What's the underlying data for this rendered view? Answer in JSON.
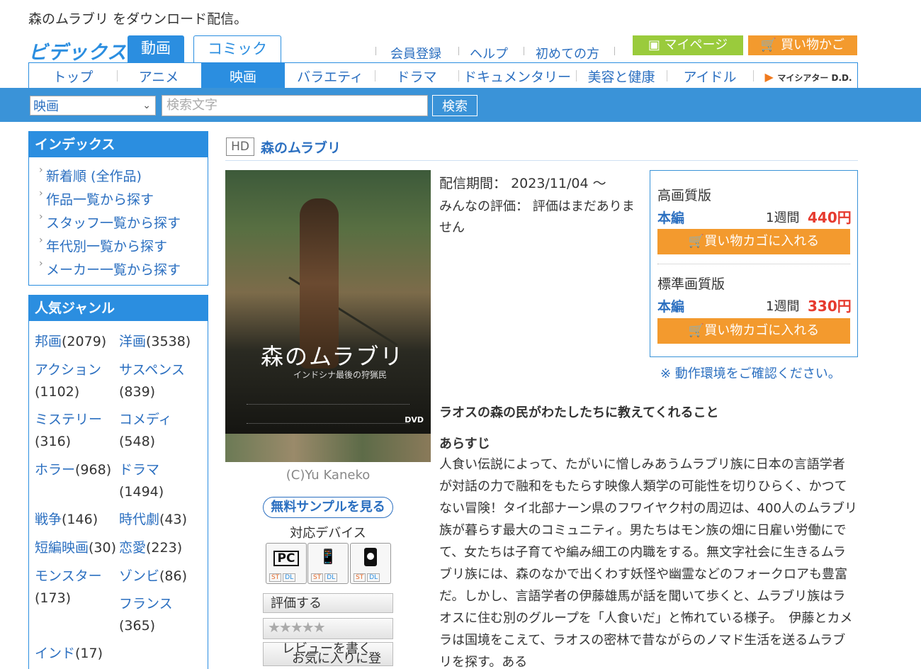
{
  "header": {
    "tagline": "森のムラブリ をダウンロード配信。",
    "logo": "ビデックス",
    "tabs": {
      "douga": "動画",
      "comic": "コミック"
    },
    "links": [
      "会員登録",
      "ヘルプ",
      "初めての方"
    ],
    "mypage": "マイページ",
    "cart": "買い物かご"
  },
  "categories": [
    "トップ",
    "アニメ",
    "映画",
    "バラエティ",
    "ドラマ",
    "ドキュメンタリー",
    "美容と健康",
    "アイドル",
    "マイシアター D.D."
  ],
  "search": {
    "selected": "映画",
    "placeholder": "検索文字",
    "button": "検索"
  },
  "sidebar": {
    "index_title": "インデックス",
    "index_items": [
      "新着順 (全作品)",
      "作品一覧から探す",
      "スタッフ一覧から探す",
      "年代別一覧から探す",
      "メーカー一覧から探す"
    ],
    "genre_title": "人気ジャンル",
    "genres": [
      {
        "name": "邦画",
        "count": "(2079)"
      },
      {
        "name": "洋画",
        "count": "(3538)"
      },
      {
        "name": "アクション",
        "count": "(1102)"
      },
      {
        "name": "サスペンス",
        "count": "(839)"
      },
      {
        "name": "ミステリー",
        "count": "(316)"
      },
      {
        "name": "コメディ",
        "count": "(548)"
      },
      {
        "name": "ホラー",
        "count": "(968)"
      },
      {
        "name": "ドラマ",
        "count": "(1494)"
      },
      {
        "name": "戦争",
        "count": "(146)"
      },
      {
        "name": "時代劇",
        "count": "(43)"
      },
      {
        "name": "短編映画",
        "count": "(30)"
      },
      {
        "name": "恋愛",
        "count": "(223)"
      },
      {
        "name": "モンスター",
        "count": "(173)"
      },
      {
        "name": "ゾンビ",
        "count": "(86)"
      },
      {
        "name": "フランス",
        "count": "(365)"
      },
      {
        "name": "インド",
        "count": "(17)"
      }
    ]
  },
  "product": {
    "badge": "HD",
    "title": "森のムラブリ",
    "poster_title": "森のムラブリ",
    "poster_subtitle": "インドシナ最後の狩猟民",
    "poster_dvd": "DVD",
    "copyright": "(C)Yu Kaneko",
    "sample_button": "無料サンプルを見る",
    "device_label": "対応デバイス",
    "devices": [
      {
        "icon": "PC",
        "st": "ST",
        "dl": "DL"
      },
      {
        "icon": "📱",
        "st": "ST",
        "dl": "DL"
      },
      {
        "icon": "",
        "st": "ST",
        "dl": "DL"
      }
    ],
    "rate_button": "評価する",
    "stars": "★★★★★",
    "review_button": "レビューを書く",
    "favorite_button": "お気に入りに登",
    "period_label": "配信期間：",
    "period_value": "2023/11/04 〜",
    "rating_label": "みんなの評価：",
    "rating_value": "評価はまだありません"
  },
  "purchase": {
    "hq_label": "高画質版",
    "sd_label": "標準画質版",
    "honpen": "本編",
    "period": "1週間",
    "hq_price": "440円",
    "sd_price": "330円",
    "cart_button": "買い物カゴに入れる"
  },
  "env_note": "※ 動作環境をご確認ください。",
  "catchcopy": "ラオスの森の民がわたしたちに教えてくれること",
  "synopsis_head": "あらすじ",
  "synopsis": "人食い伝説によって、たがいに憎しみあうムラブリ族に日本の言語学者が対話の力で融和をもたらす映像人類学の可能性を切りひらく、かつてない冒険！タイ北部ナーン県のフワイヤク村の周辺は、400人のムラブリ族が暮らす最大のコミュニティ。男たちはモン族の畑に日雇い労働にでて、女たちは子育てや編み細工の内職をする。無文字社会に生きるムラブリ族には、森のなかで出くわす妖怪や幽霊などのフォークロアも豊富だ。しかし、言語学者の伊藤雄馬が話を聞いて歩くと、ムラブリ族はラオスに住む別のグループを「人食いだ」と怖れている様子。　伊藤とカメラは国境をこえて、ラオスの密林で昔ながらのノマド生活を送るムラブリを探す。ある"
}
